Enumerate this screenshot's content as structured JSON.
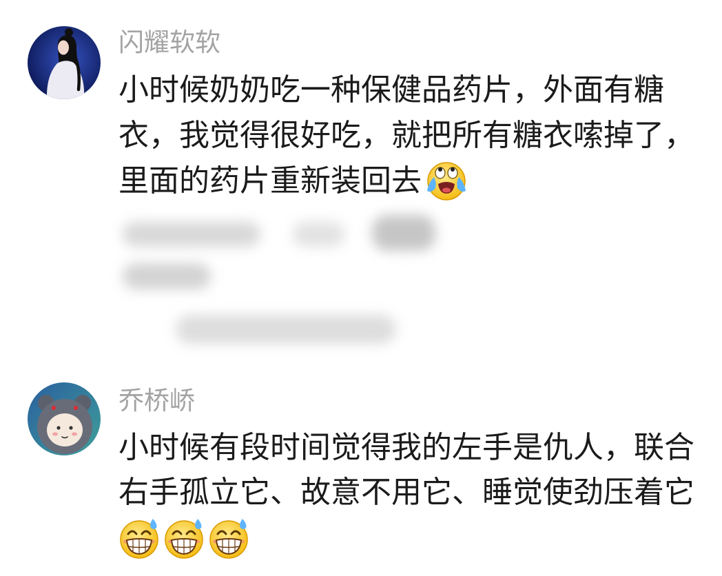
{
  "comments": [
    {
      "username": "闪耀软软",
      "avatar_icon": "girl-avatar-icon",
      "lines": [
        "小时候奶奶吃一种保健品药片，外面有糖",
        "衣，我觉得很好吃，就把所有糖衣嗦掉了，",
        "里面的药片重新装回去"
      ],
      "emojis": [
        "crying-laughing-emoji-icon"
      ]
    },
    {
      "username": "乔桥峤",
      "avatar_icon": "cartoon-wolf-avatar-icon",
      "lines": [
        "小时候有段时间觉得我的左手是仇人，联合",
        "右手孤立它、故意不用它、睡觉使劲压着它"
      ],
      "emojis": [
        "grin-sweat-emoji-icon",
        "grin-sweat-emoji-icon",
        "grin-sweat-emoji-icon"
      ]
    }
  ],
  "colors": {
    "background": "#ffffff",
    "text": "#1b1b1b",
    "username": "#a3a3a3",
    "emoji_yellow": "#f7c21c",
    "tear_blue": "#5fb4ff"
  }
}
